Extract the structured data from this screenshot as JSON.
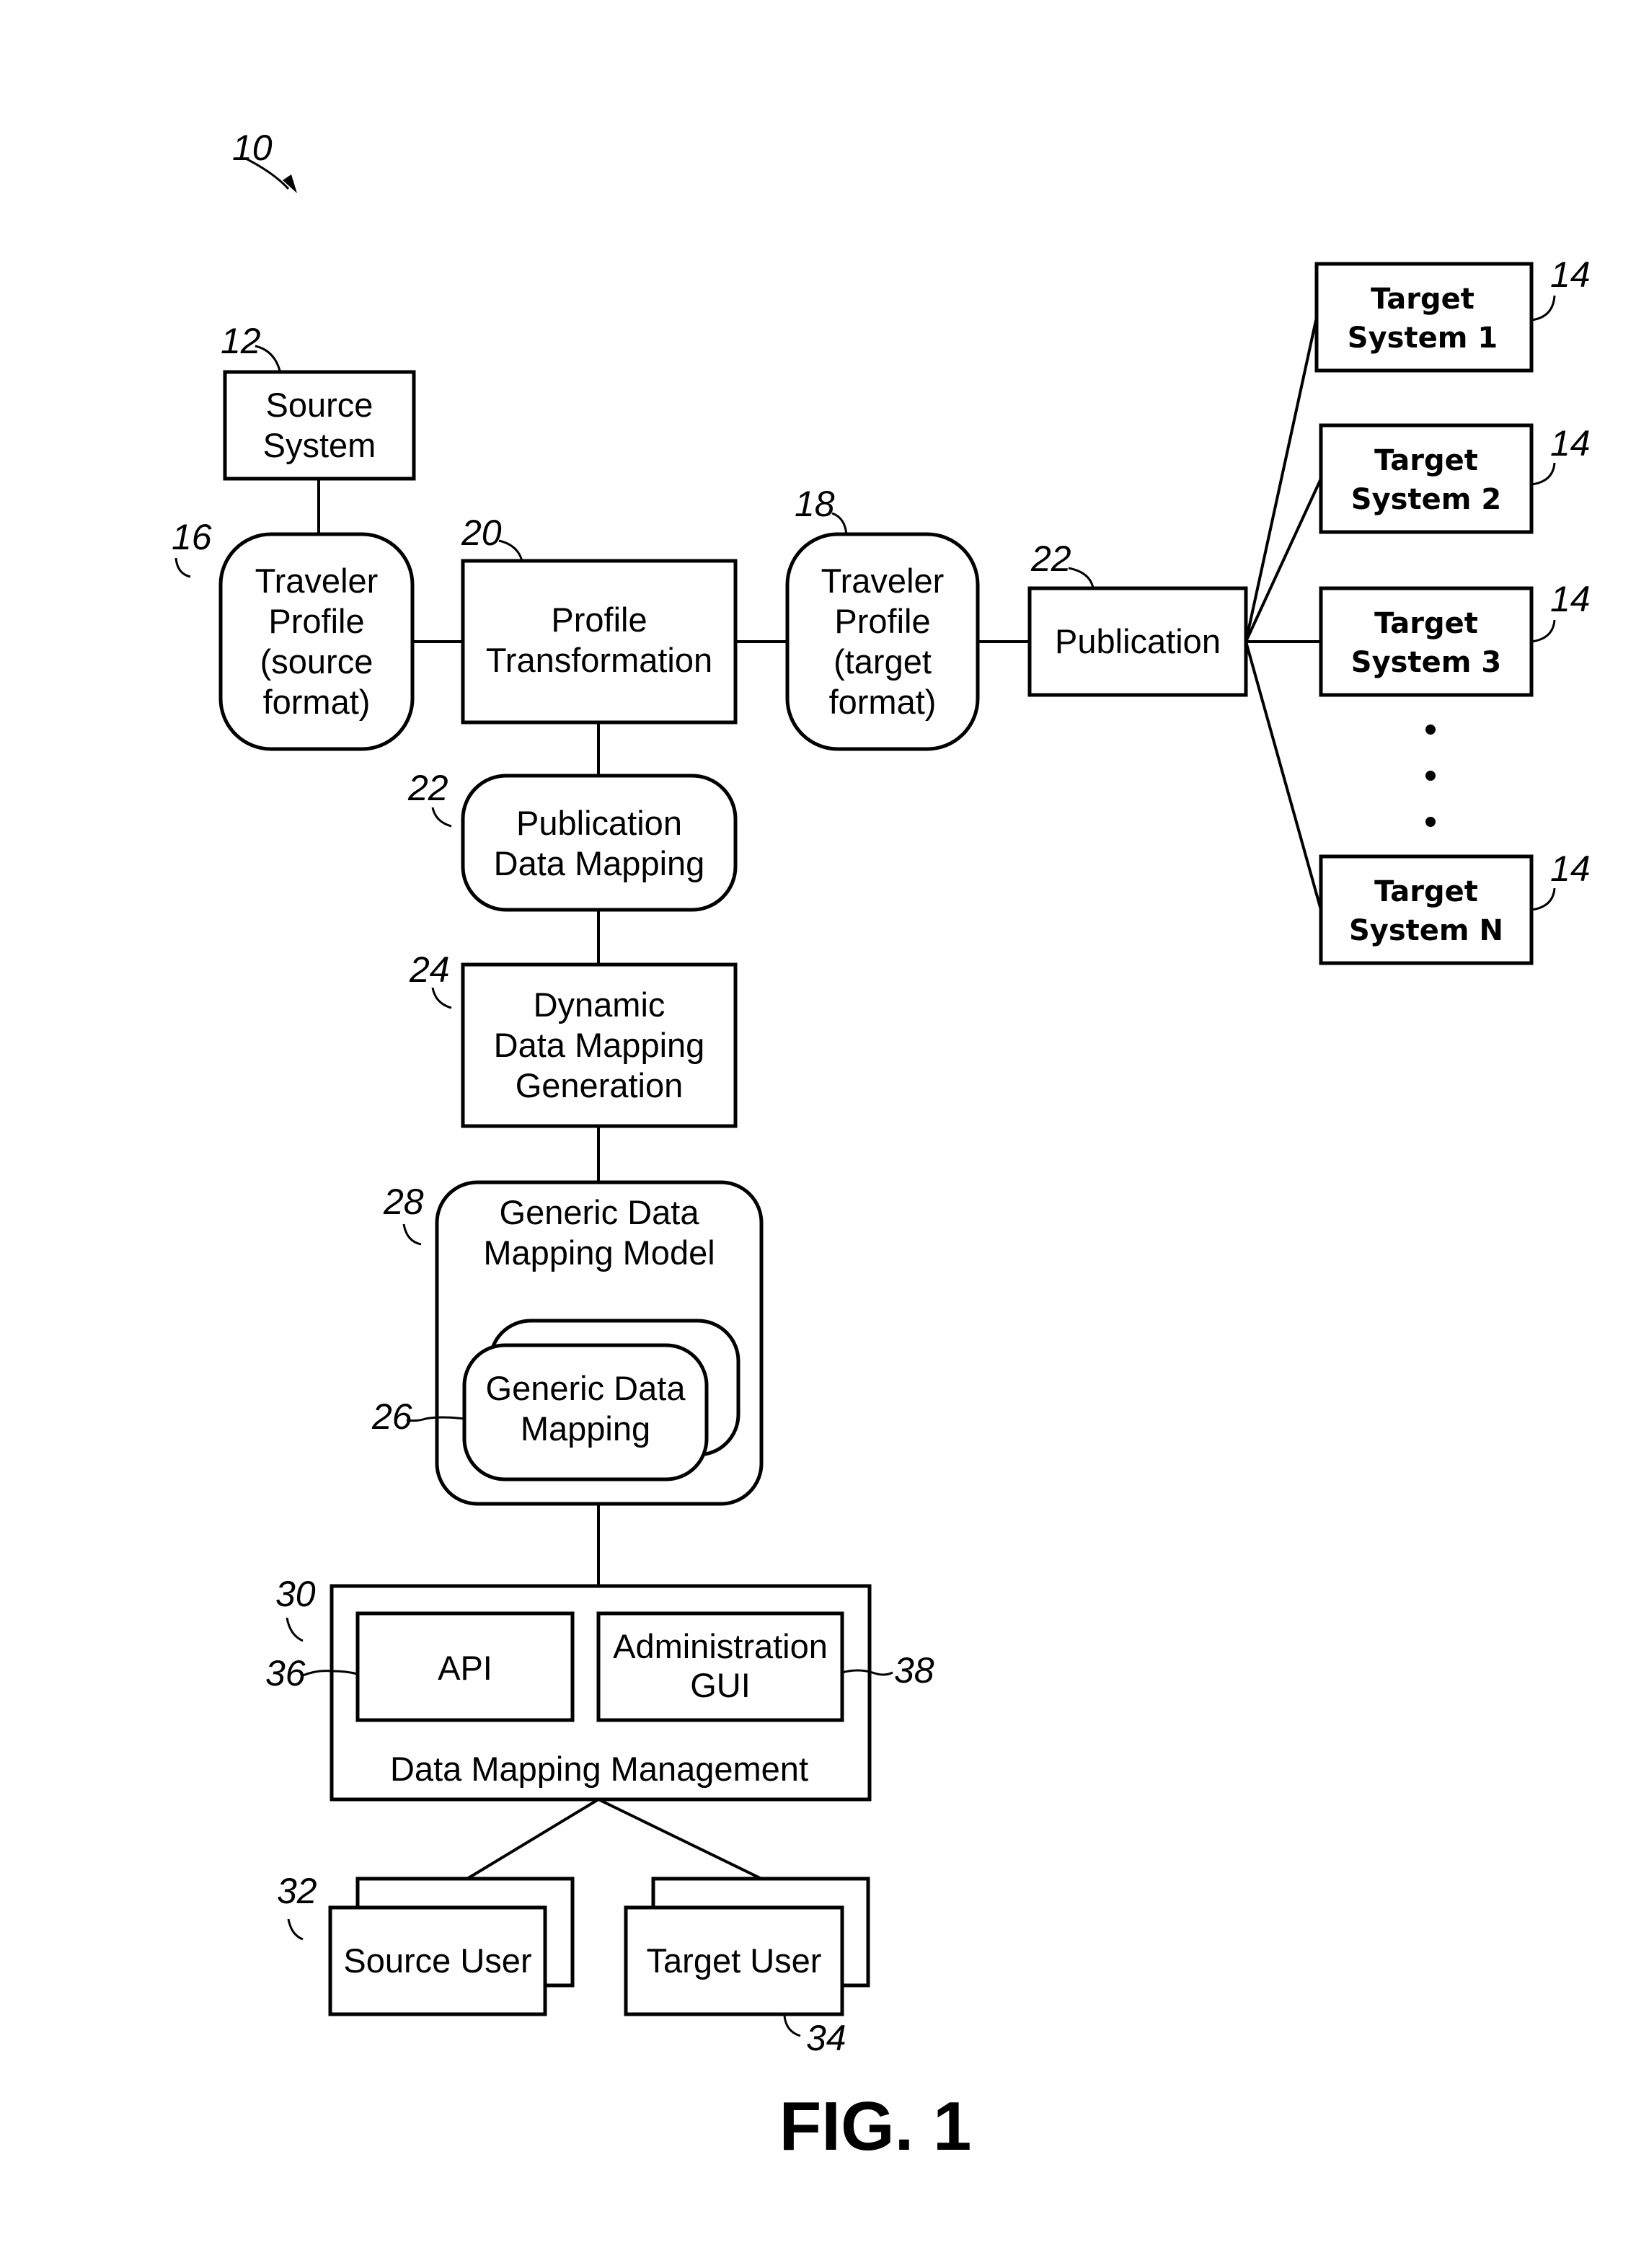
{
  "figure": {
    "caption": "FIG. 1",
    "system_ref": "10"
  },
  "nodes": {
    "source_system": {
      "ref": "12",
      "lines": [
        "Source",
        "System"
      ]
    },
    "traveler_profile_source": {
      "ref": "16",
      "lines": [
        "Traveler",
        "Profile",
        "(source",
        "format)"
      ]
    },
    "profile_transformation": {
      "ref": "20",
      "lines": [
        "Profile",
        "Transformation"
      ]
    },
    "traveler_profile_target": {
      "ref": "18",
      "lines": [
        "Traveler",
        "Profile",
        "(target",
        "format)"
      ]
    },
    "publication": {
      "ref": "22",
      "lines": [
        "Publication"
      ]
    },
    "publication_data_mapping": {
      "ref": "22",
      "lines": [
        "Publication",
        "Data Mapping"
      ]
    },
    "dynamic_data_mapping_generation": {
      "ref": "24",
      "lines": [
        "Dynamic",
        "Data Mapping",
        "Generation"
      ]
    },
    "generic_data_mapping_model": {
      "ref": "28",
      "lines": [
        "Generic Data",
        "Mapping Model"
      ]
    },
    "generic_data_mapping": {
      "ref": "26",
      "lines": [
        "Generic Data",
        "Mapping"
      ]
    },
    "data_mapping_management": {
      "ref": "30",
      "lines": [
        "Data Mapping Management"
      ]
    },
    "api": {
      "ref": "36",
      "lines": [
        "API"
      ]
    },
    "administration_gui": {
      "ref": "38",
      "lines": [
        "Administration",
        "GUI"
      ]
    },
    "source_user": {
      "ref": "32",
      "lines": [
        "Source User"
      ]
    },
    "target_user": {
      "ref": "34",
      "lines": [
        "Target User"
      ]
    }
  },
  "target_systems": [
    {
      "ref": "14",
      "lines": [
        "Target",
        "System 1"
      ]
    },
    {
      "ref": "14",
      "lines": [
        "Target",
        "System 2"
      ]
    },
    {
      "ref": "14",
      "lines": [
        "Target",
        "System 3"
      ]
    },
    {
      "ref": "14",
      "lines": [
        "Target",
        "System N"
      ]
    }
  ],
  "ellipsis": "⋮"
}
